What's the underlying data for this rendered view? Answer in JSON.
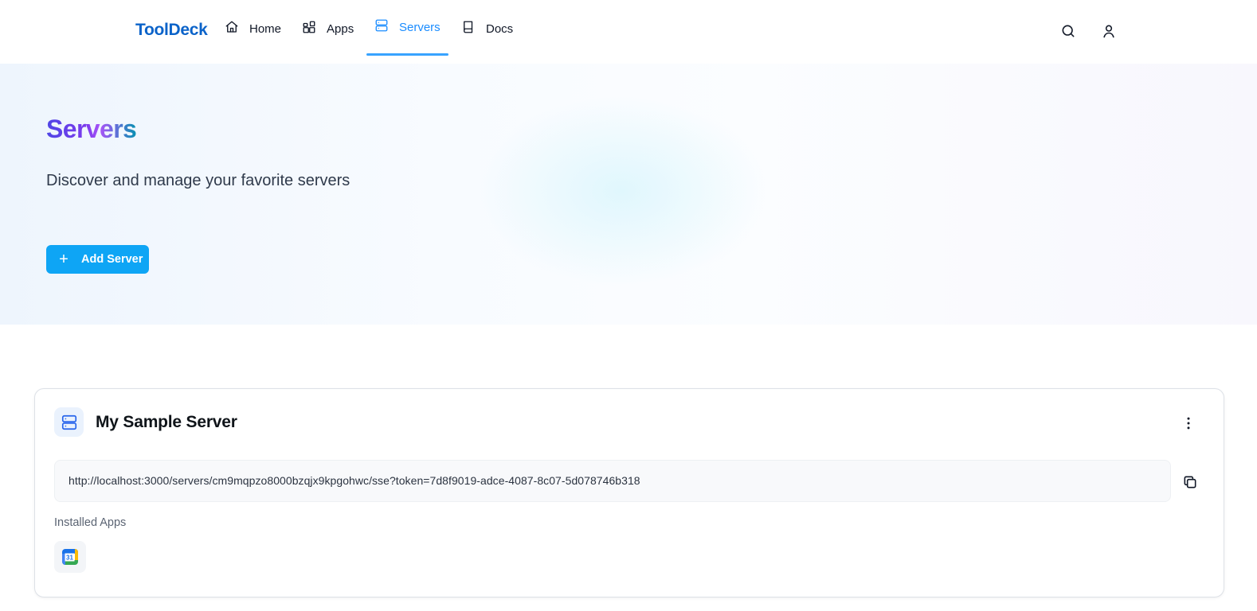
{
  "nav": {
    "brand": "ToolDeck",
    "items": [
      {
        "label": "Home",
        "icon": "home-icon"
      },
      {
        "label": "Apps",
        "icon": "apps-icon"
      },
      {
        "label": "Servers",
        "icon": "server-icon",
        "active": true
      },
      {
        "label": "Docs",
        "icon": "book-icon"
      }
    ],
    "right_icons": [
      "search-icon",
      "user-icon"
    ]
  },
  "hero": {
    "title": "Servers",
    "subtitle": "Discover and manage your favorite servers",
    "add_button_label": "Add Server"
  },
  "server": {
    "name": "My Sample Server",
    "url": "http://localhost:3000/servers/cm9mqpzo8000bzqjx9kpgohwc/sse?token=7d8f9019-adce-4087-8c07-5d078746b318",
    "installed_apps_label": "Installed Apps",
    "installed_apps": [
      {
        "icon": "google-calendar-icon",
        "text": "31"
      }
    ]
  },
  "colors": {
    "brand": "#0b63c9",
    "accent": "#1a8cff",
    "button": "#0ea5f5"
  }
}
